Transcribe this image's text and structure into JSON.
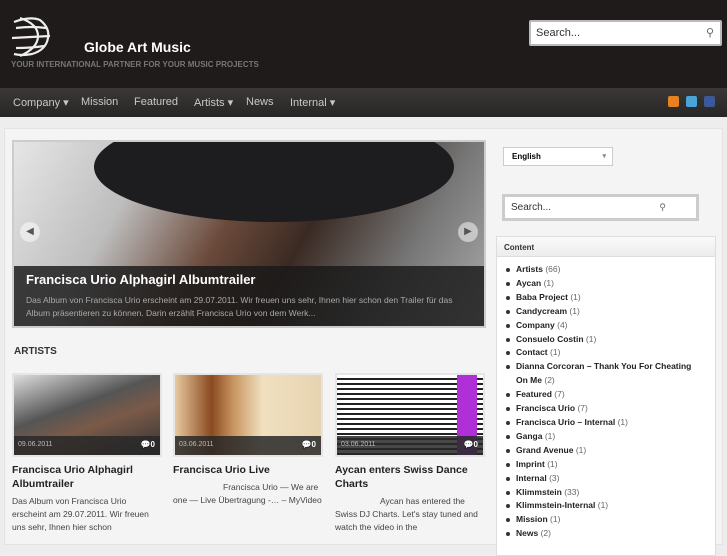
{
  "header": {
    "title": "Globe Art Music",
    "tagline": "YOUR INTERNATIONAL PARTNER FOR YOUR MUSIC PROJECTS",
    "search_placeholder": "Search..."
  },
  "nav": {
    "items": [
      "Company ▾",
      "Mission",
      "Featured",
      "Artists ▾",
      "News",
      "Internal ▾"
    ]
  },
  "social": [
    {
      "icon": "rss-icon",
      "color": "#e8821e"
    },
    {
      "icon": "twitter-icon",
      "color": "#4aa5d6"
    },
    {
      "icon": "facebook-icon",
      "color": "#3b5998"
    }
  ],
  "slider": {
    "title": "Francisca Urio Alphagirl Albumtrailer",
    "excerpt": "Das Album von Francisca Urio erscheint am 29.07.2011. Wir freuen uns sehr, Ihnen hier schon den Trailer für das Album präsentieren zu können. Darin erzählt Francisca Urio von dem Werk..."
  },
  "artists": {
    "heading": "ARTISTS",
    "cards": [
      {
        "date": "09.06.2011",
        "comments": "0",
        "title": "Francisca Urio Alphagirl Albumtrailer",
        "excerpt": "Das Album von Francisca Urio erscheint am 29.07.2011. Wir freuen uns sehr, Ihnen hier schon"
      },
      {
        "date": "03.06.2011",
        "comments": "0",
        "title": "Francisca Urio Live",
        "excerpt": "Francisca Urio — We are one — Live Übertragung -… – MyVideo"
      },
      {
        "date": "03.06.2011",
        "comments": "0",
        "title": "Aycan enters Swiss Dance Charts",
        "excerpt": "Aycan has entered the Swiss DJ Charts. Let's stay tuned and watch the video in the"
      }
    ]
  },
  "sidebar": {
    "language": "English",
    "search_placeholder": "Search...",
    "widget_title": "Content",
    "categories": [
      {
        "name": "Artists",
        "count": "(66)"
      },
      {
        "name": "Aycan",
        "count": "(1)"
      },
      {
        "name": "Baba Project",
        "count": "(1)"
      },
      {
        "name": "Candycream",
        "count": "(1)"
      },
      {
        "name": "Company",
        "count": "(4)"
      },
      {
        "name": "Consuelo Costin",
        "count": "(1)"
      },
      {
        "name": "Contact",
        "count": "(1)"
      },
      {
        "name": "Dianna Corcoran – Thank You For Cheating On Me",
        "count": "(2)"
      },
      {
        "name": "Featured",
        "count": "(7)"
      },
      {
        "name": "Francisca Urio",
        "count": "(7)"
      },
      {
        "name": "Francisca Urio – Internal",
        "count": "(1)"
      },
      {
        "name": "Ganga",
        "count": "(1)"
      },
      {
        "name": "Grand Avenue",
        "count": "(1)"
      },
      {
        "name": "Imprint",
        "count": "(1)"
      },
      {
        "name": "Internal",
        "count": "(3)"
      },
      {
        "name": "Klimmstein",
        "count": "(33)"
      },
      {
        "name": "Klimmstein-Internal",
        "count": "(1)"
      },
      {
        "name": "Mission",
        "count": "(1)"
      },
      {
        "name": "News",
        "count": "(2)"
      }
    ]
  }
}
